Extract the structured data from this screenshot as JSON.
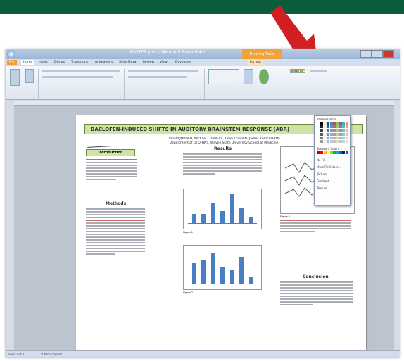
{
  "window": {
    "title": "POSTER.pptx - Microsoft PowerPoint",
    "context_tab": "Drawing Tools"
  },
  "tabs": [
    "File",
    "Home",
    "Insert",
    "Design",
    "Transitions",
    "Animations",
    "Slide Show",
    "Review",
    "View",
    "Developer",
    "Format"
  ],
  "ribbon": {
    "shape_fill_label": "Shape Fill",
    "theme_colors_label": "Theme Colors",
    "standard_colors_label": "Standard Colors",
    "no_fill": "No Fill",
    "more_fill_colors": "More Fill Colors...",
    "picture": "Picture...",
    "gradient": "Gradient",
    "texture": "Texture"
  },
  "poster": {
    "title": "BACLOFEN-INDUCED SHIFTS IN AUDITORY BRAINSTEM RESPONSE (ABR)",
    "authors_line1": "Donald JORDAN, Michael CONNELL, Kevin O'BRIEN, James KALTOVAKOS",
    "authors_line2": "Department of OTO-HNS, Wayne State University School of Medicine",
    "introduction": "Introduction",
    "methods": "Methods",
    "results": "Results",
    "conclusion": "Conclusion",
    "figure1": "Figure 1",
    "figure2": "Figure 2",
    "figure3": "Figure 3"
  },
  "chart_data": [
    {
      "type": "bar",
      "values": [
        0.3,
        0.3,
        0.7,
        0.4,
        1.0,
        0.5,
        0.2
      ]
    },
    {
      "type": "bar",
      "values": [
        0.6,
        0.7,
        0.9,
        0.5,
        0.4,
        0.8,
        0.2
      ]
    }
  ],
  "status": {
    "slide": "Slide 1 of 1",
    "theme": "\"Office Theme\""
  },
  "colors": {
    "banner": "#cfe3a6",
    "bars": "#4a7ec2",
    "arrow": "#d21f23"
  }
}
